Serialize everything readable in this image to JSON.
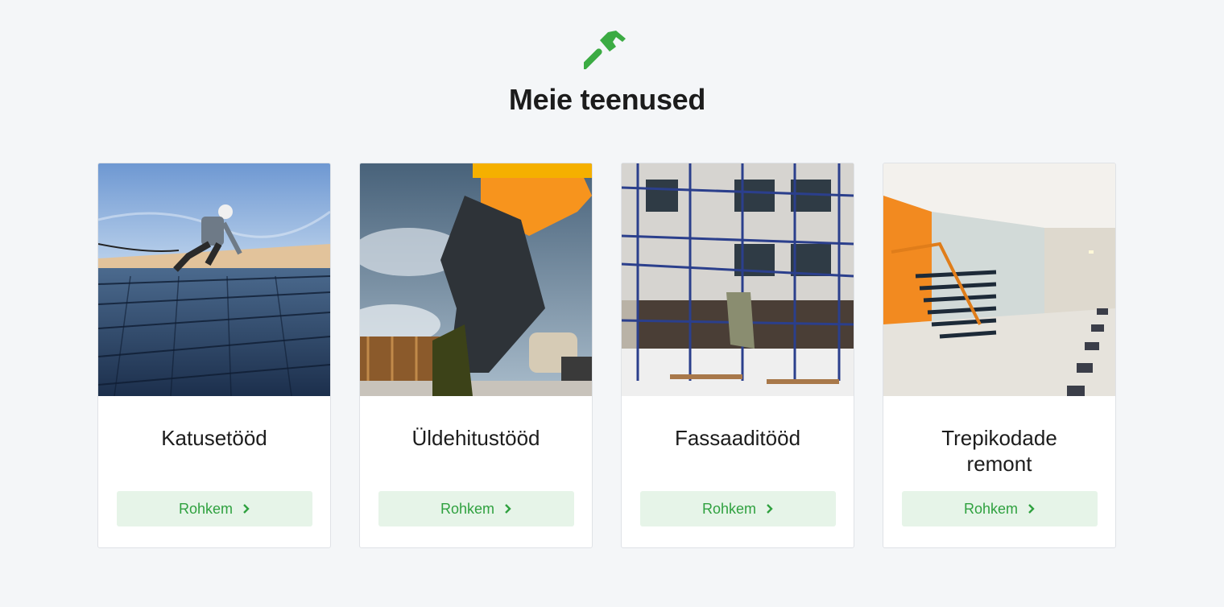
{
  "section": {
    "icon": "hammer-icon",
    "title": "Meie teenused",
    "accent_color": "#3bab43"
  },
  "services": [
    {
      "title": "Katusetööd",
      "button_label": "Rohkem",
      "image": "roof-worker-photo"
    },
    {
      "title": "Üldehitustööd",
      "button_label": "Rohkem",
      "image": "construction-worker-drill-photo"
    },
    {
      "title": "Fassaaditööd",
      "button_label": "Rohkem",
      "image": "facade-scaffolding-photo"
    },
    {
      "title": "Trepikodade remont",
      "button_label": "Rohkem",
      "image": "stairwell-photo"
    }
  ]
}
